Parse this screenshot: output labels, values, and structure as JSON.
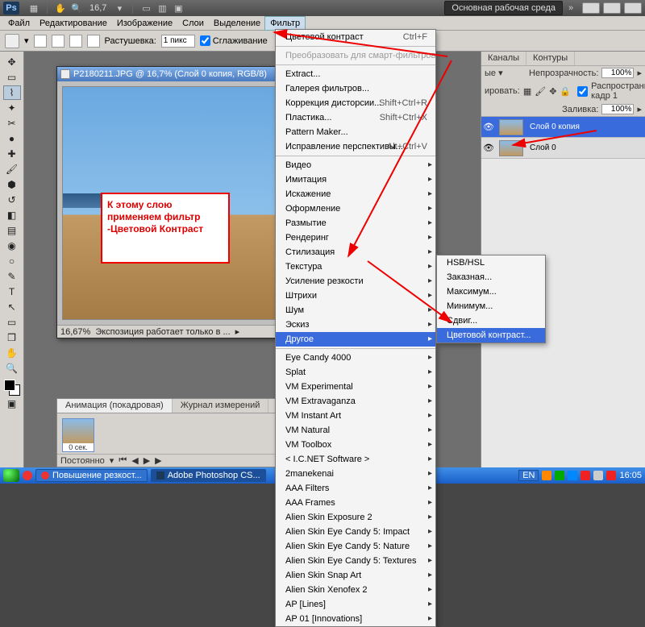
{
  "titlebar": {
    "zoom": "16,7",
    "workspace": "Основная рабочая среда"
  },
  "menubar": {
    "items": [
      "Файл",
      "Редактирование",
      "Изображение",
      "Слои",
      "Выделение",
      "Фильтр"
    ],
    "highlighted": "Фильтр"
  },
  "optionsbar": {
    "feather_label": "Растушевка:",
    "feather_value": "1 пикс",
    "antialias_label": "Сглаживание",
    "antialias_checked": true
  },
  "document": {
    "title": "P2180211.JPG @ 16,7% (Слой 0 копия, RGB/8)",
    "status_zoom": "16,67%",
    "status_text": "Экспозиция работает только в ..."
  },
  "annotation": "К этому слою применяем фильтр -Цветовой Контраст",
  "bottom_panel": {
    "tabs": [
      "Анимация (покадровая)",
      "Журнал измерений"
    ],
    "active": 0,
    "frame_label": "0 сек.",
    "mode": "Постоянно"
  },
  "right_panel": {
    "top_tabs": [
      "Каналы",
      "Контуры"
    ],
    "opacity_label": "Непрозрачность:",
    "opacity_value": "100%",
    "fill_label": "Заливка:",
    "fill_value": "100%",
    "lock_label": "ировать:",
    "propagate_label": "Распространить кадр 1",
    "layers": [
      {
        "name": "Слой 0 копия",
        "selected": true
      },
      {
        "name": "Слой 0",
        "selected": false
      }
    ]
  },
  "filter_menu": {
    "top": [
      {
        "label": "Цветовой контраст",
        "shortcut": "Ctrl+F"
      },
      {
        "label": "Преобразовать для смарт-фильтров",
        "disabled": true
      }
    ],
    "group1": [
      {
        "label": "Extract..."
      },
      {
        "label": "Галерея фильтров..."
      },
      {
        "label": "Коррекция дисторсии...",
        "shortcut": "Shift+Ctrl+R"
      },
      {
        "label": "Пластика...",
        "shortcut": "Shift+Ctrl+X"
      },
      {
        "label": "Pattern Maker..."
      },
      {
        "label": "Исправление перспективы...",
        "shortcut": "Alt+Ctrl+V"
      }
    ],
    "submenus": [
      "Видео",
      "Имитация",
      "Искажение",
      "Оформление",
      "Размытие",
      "Рендеринг",
      "Стилизация",
      "Текстура",
      "Усиление резкости",
      "Штрихи",
      "Шум",
      "Эскиз",
      "Другое"
    ],
    "highlighted_submenu": "Другое",
    "plugins": [
      "Eye Candy 4000",
      "Splat",
      "VM Experimental",
      "VM Extravaganza",
      "VM Instant Art",
      "VM Natural",
      "VM Toolbox",
      "< I.C.NET Software >",
      "2manekenai",
      "AAA Filters",
      "AAA Frames",
      "Alien Skin Exposure 2",
      "Alien Skin Eye Candy 5: Impact",
      "Alien Skin Eye Candy 5: Nature",
      "Alien Skin Eye Candy 5: Textures",
      "Alien Skin Snap Art",
      "Alien Skin Xenofex 2",
      "AP [Lines]",
      "AP 01 [Innovations]"
    ]
  },
  "other_menu": {
    "items": [
      "HSB/HSL",
      "Заказная...",
      "Максимум...",
      "Минимум...",
      "Сдвиг...",
      "Цветовой контраст..."
    ],
    "highlighted": "Цветовой контраст..."
  },
  "taskbar": {
    "buttons": [
      "Повышение резкост...",
      "Adobe Photoshop CS..."
    ],
    "active": 1,
    "lang": "EN",
    "clock": "16:05"
  }
}
